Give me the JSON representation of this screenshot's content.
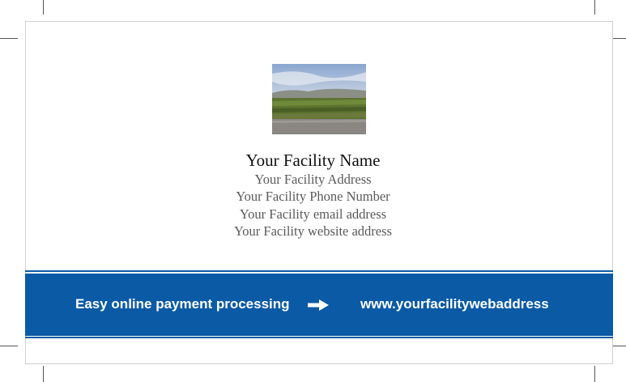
{
  "card": {
    "facility_name": "Your Facility Name",
    "address": "Your Facility Address",
    "phone": "Your Facility Phone Number",
    "email": "Your Facility email address",
    "website": "Your Facility website address"
  },
  "banner": {
    "tagline": "Easy online payment processing",
    "arrow_icon": "right-arrow-icon",
    "web_address": "www.yourfacilitywebaddress",
    "color": "#0b5aa6"
  }
}
